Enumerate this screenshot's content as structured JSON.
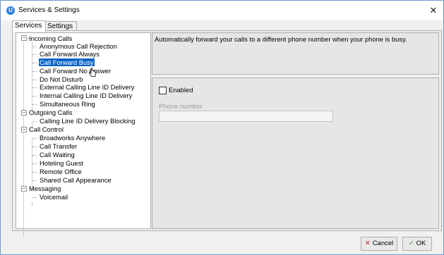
{
  "window": {
    "title": "Services & Settings",
    "app_icon_glyph": "U",
    "close_glyph": "✕"
  },
  "tabs": [
    {
      "label": "Services",
      "active": true
    },
    {
      "label": "Settings",
      "active": false
    }
  ],
  "tree": {
    "groups": [
      {
        "label": "Incoming Calls",
        "items": [
          "Anonymous Call Rejection",
          "Call Forward Always",
          "Call Forward Busy",
          "Call Forward No Answer",
          "Do Not Disturb",
          "External Calling Line ID Delivery",
          "Internal Calling Line ID Delivery",
          "Simultaneous Ring"
        ]
      },
      {
        "label": "Outgoing Calls",
        "items": [
          "Calling Line ID Delivery Blocking"
        ]
      },
      {
        "label": "Call Control",
        "items": [
          "Broadworks Anywhere",
          "Call Transfer",
          "Call Waiting",
          "Hoteling Guest",
          "Remote Office",
          "Shared Call Appearance"
        ]
      },
      {
        "label": "Messaging",
        "items": [
          "Voicemail"
        ]
      }
    ],
    "selected": "Call Forward Busy",
    "collapse_glyph": "−"
  },
  "description": "Automatically forward your calls to a different phone number when your phone is busy.",
  "settings": {
    "enabled_label": "Enabled",
    "enabled_checked": false,
    "phone_label": "Phone number",
    "phone_value": ""
  },
  "buttons": {
    "cancel_label": "Cancel",
    "cancel_icon": "✕",
    "ok_label": "OK",
    "ok_icon": "✓"
  },
  "colors": {
    "selection": "#0a64c8",
    "app_icon": "#2f7fd6",
    "cancel_icon": "#d03030",
    "ok_icon": "#3a9a3a"
  }
}
